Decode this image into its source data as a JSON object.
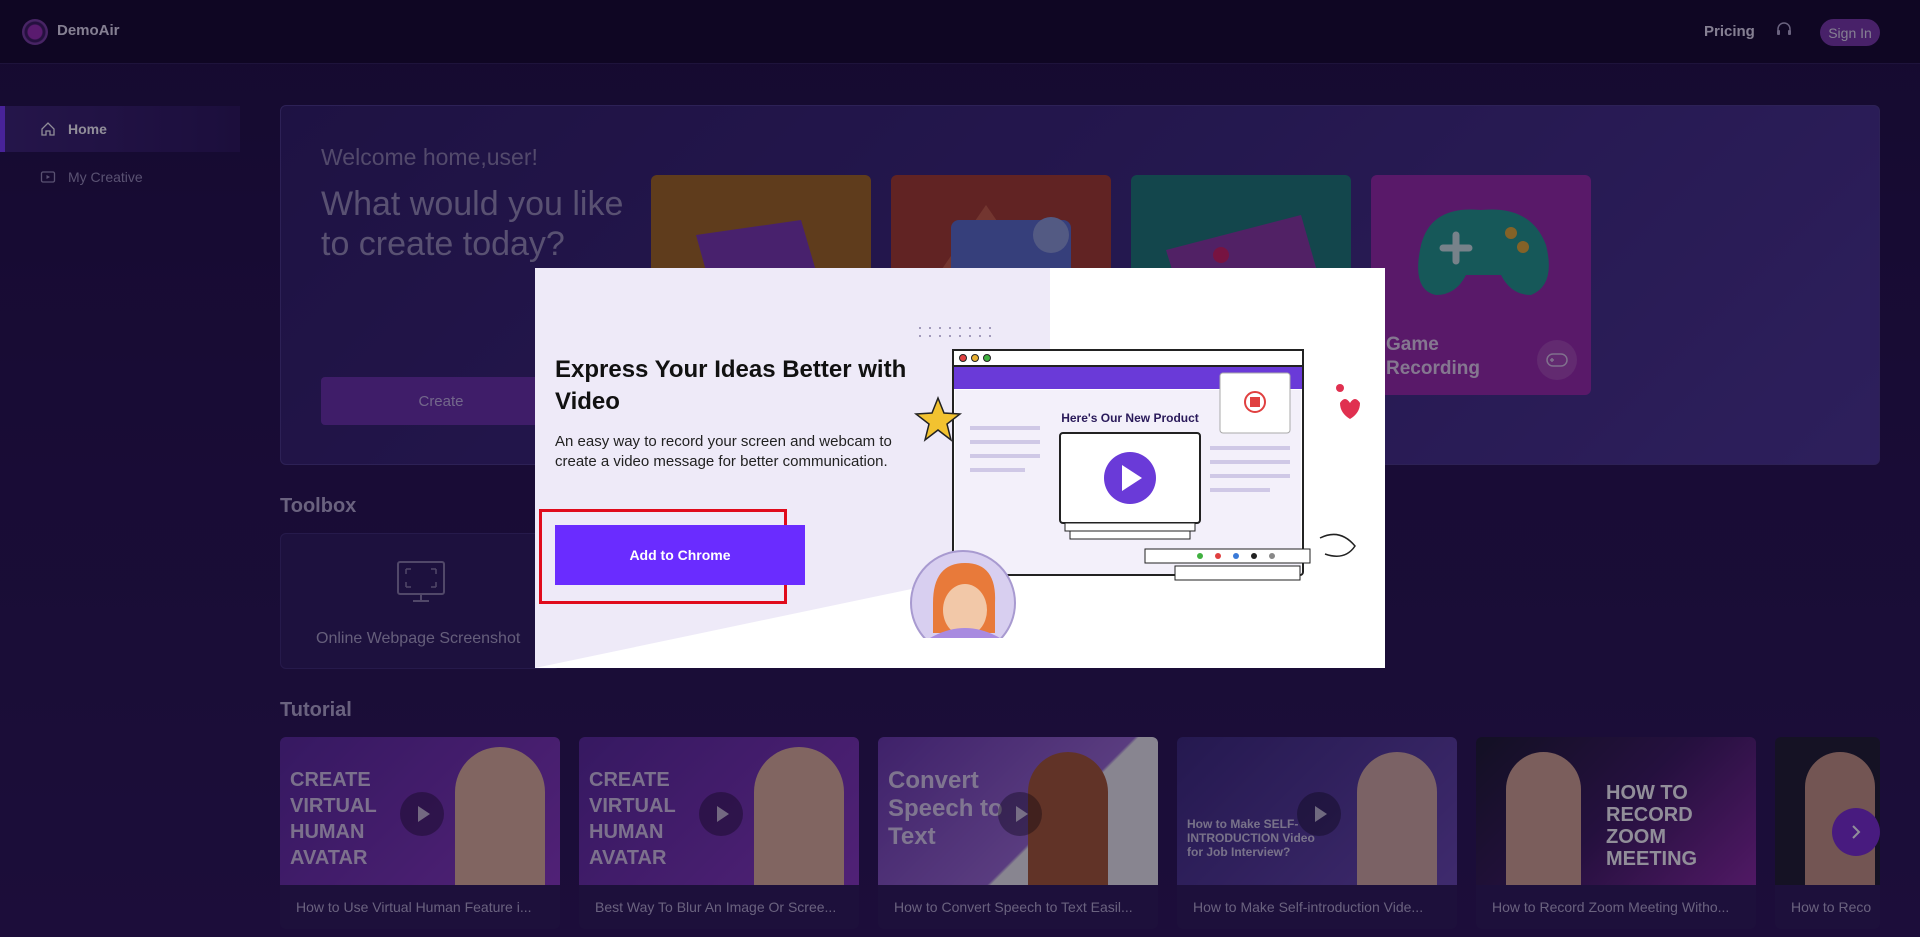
{
  "header": {
    "brand": "DemoAir",
    "pricing": "Pricing",
    "sign_in": "Sign In"
  },
  "sidebar": {
    "items": [
      {
        "label": "Home",
        "icon": "home-icon",
        "active": true
      },
      {
        "label": "My Creative",
        "icon": "video-icon",
        "active": false
      }
    ]
  },
  "welcome": {
    "subtitle": "Welcome home,user!",
    "title": "What would you like to create today?",
    "create_label": "Create",
    "tiles": [
      {
        "label": ""
      },
      {
        "label": ""
      },
      {
        "label": ""
      },
      {
        "label": "Game Recording"
      }
    ]
  },
  "toolbox": {
    "title": "Toolbox",
    "tools": [
      {
        "label": "Online Webpage Screenshot",
        "icon": "monitor-icon"
      }
    ]
  },
  "tutorial": {
    "title": "Tutorial",
    "items": [
      {
        "label": "How to Use Virtual Human Feature i...",
        "thumb_text": "CREATE VIRTUAL HUMAN AVATAR"
      },
      {
        "label": "Best Way To Blur An Image Or Scree...",
        "thumb_text": "CREATE VIRTUAL HUMAN AVATAR"
      },
      {
        "label": "How to Convert Speech to Text Easil...",
        "thumb_text": "Convert Speech to Text"
      },
      {
        "label": "How to Make Self-introduction Vide...",
        "thumb_text": "How to Make SELF-INTRODUCTION Video for Job Interview?"
      },
      {
        "label": "How to Record Zoom Meeting Witho...",
        "thumb_text": "HOW TO RECORD ZOOM MEETING"
      },
      {
        "label": "How to Reco",
        "thumb_text": ""
      }
    ]
  },
  "modal": {
    "title": "Express Your Ideas Better with Video",
    "description": "An easy way to record your screen and webcam to create a video message for better communication.",
    "cta": "Add to Chrome",
    "illustration_heading": "Here's Our New Product"
  },
  "colors": {
    "accent": "#6a2cff",
    "highlight": "#e00b1c",
    "header_bg": "#130829"
  }
}
